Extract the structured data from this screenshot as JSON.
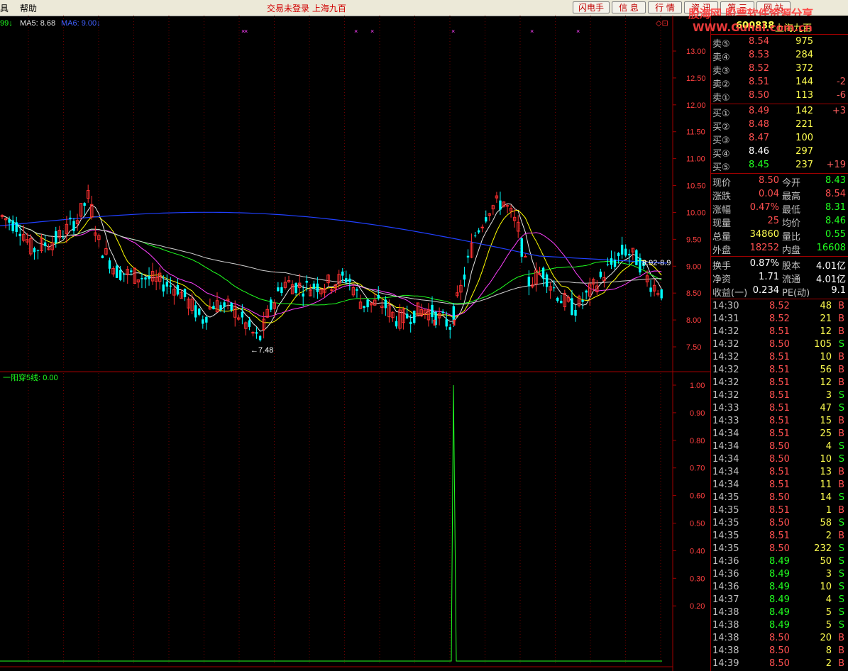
{
  "menubar": {
    "items": [
      "具",
      "帮助"
    ],
    "center_text": "交易未登录  上海九百",
    "buttons": [
      "闪电手",
      "信 息",
      "行 情",
      "资 讯",
      "第 三",
      "网 站"
    ]
  },
  "watermark": {
    "line1": "股海网 股票软件资源分享",
    "line2": "WWW.Guhai.com.cn"
  },
  "stock": {
    "code": "600838",
    "name": "上海九百"
  },
  "ma_legend": {
    "lead": "99↓",
    "ma5": "MA5: 8.68",
    "ma6": "MA6: 9.00↓"
  },
  "price_axis": [
    "13.00",
    "12.50",
    "12.00",
    "11.50",
    "11.00",
    "10.50",
    "10.00",
    "9.50",
    "9.00",
    "8.50",
    "8.00",
    "7.50"
  ],
  "price_annotations": {
    "low": "←7.48",
    "right_label": "8.92-8.9"
  },
  "indicator": {
    "title": "一阳穿5线: 0.00",
    "axis": [
      "1.00",
      "0.90",
      "0.80",
      "0.70",
      "0.60",
      "0.50",
      "0.40",
      "0.30",
      "0.20"
    ]
  },
  "order_book": {
    "sell": [
      {
        "label": "卖⑤",
        "price": "8.54",
        "vol": "975",
        "chg": ""
      },
      {
        "label": "卖④",
        "price": "8.53",
        "vol": "284",
        "chg": ""
      },
      {
        "label": "卖③",
        "price": "8.52",
        "vol": "372",
        "chg": ""
      },
      {
        "label": "卖②",
        "price": "8.51",
        "vol": "144",
        "chg": "-2"
      },
      {
        "label": "卖①",
        "price": "8.50",
        "vol": "113",
        "chg": "-6"
      }
    ],
    "buy": [
      {
        "label": "买①",
        "price": "8.49",
        "vol": "142",
        "chg": "+3"
      },
      {
        "label": "买②",
        "price": "8.48",
        "vol": "221",
        "chg": ""
      },
      {
        "label": "买③",
        "price": "8.47",
        "vol": "100",
        "chg": ""
      },
      {
        "label": "买④",
        "price": "8.46",
        "vol": "297",
        "chg": ""
      },
      {
        "label": "买⑤",
        "price": "8.45",
        "vol": "237",
        "chg": "+19"
      }
    ]
  },
  "quote": {
    "rows": [
      {
        "l1": "现价",
        "v1": "8.50",
        "l2": "今开",
        "v2": "8.43"
      },
      {
        "l1": "涨跌",
        "v1": "0.04",
        "l2": "最高",
        "v2": "8.54"
      },
      {
        "l1": "涨幅",
        "v1": "0.47%",
        "l2": "最低",
        "v2": "8.31"
      },
      {
        "l1": "现量",
        "v1": "25",
        "l2": "均价",
        "v2": "8.46"
      },
      {
        "l1": "总量",
        "v1": "34860",
        "l2": "量比",
        "v2": "0.55"
      },
      {
        "l1": "外盘",
        "v1": "18252",
        "l2": "内盘",
        "v2": "16608"
      }
    ],
    "rows2": [
      {
        "l1": "换手",
        "v1": "0.87%",
        "l2": "股本",
        "v2": "4.01亿"
      },
      {
        "l1": "净资",
        "v1": "1.71",
        "l2": "流通",
        "v2": "4.01亿"
      },
      {
        "l1": "收益(一)",
        "v1": "0.234",
        "l2": "PE(动)",
        "v2": "9.1"
      }
    ]
  },
  "ticks": [
    {
      "t": "14:30",
      "p": "8.52",
      "v": "48",
      "s": "B"
    },
    {
      "t": "14:31",
      "p": "8.52",
      "v": "21",
      "s": "B"
    },
    {
      "t": "14:32",
      "p": "8.51",
      "v": "12",
      "s": "B"
    },
    {
      "t": "14:32",
      "p": "8.50",
      "v": "105",
      "s": "S"
    },
    {
      "t": "14:32",
      "p": "8.51",
      "v": "10",
      "s": "B"
    },
    {
      "t": "14:32",
      "p": "8.51",
      "v": "56",
      "s": "B"
    },
    {
      "t": "14:32",
      "p": "8.51",
      "v": "12",
      "s": "B"
    },
    {
      "t": "14:32",
      "p": "8.51",
      "v": "3",
      "s": "S"
    },
    {
      "t": "14:33",
      "p": "8.51",
      "v": "47",
      "s": "S"
    },
    {
      "t": "14:33",
      "p": "8.51",
      "v": "15",
      "s": "B"
    },
    {
      "t": "14:34",
      "p": "8.51",
      "v": "25",
      "s": "B"
    },
    {
      "t": "14:34",
      "p": "8.50",
      "v": "4",
      "s": "S"
    },
    {
      "t": "14:34",
      "p": "8.50",
      "v": "10",
      "s": "S"
    },
    {
      "t": "14:34",
      "p": "8.51",
      "v": "13",
      "s": "B"
    },
    {
      "t": "14:34",
      "p": "8.51",
      "v": "11",
      "s": "B"
    },
    {
      "t": "14:35",
      "p": "8.50",
      "v": "14",
      "s": "S"
    },
    {
      "t": "14:35",
      "p": "8.51",
      "v": "1",
      "s": "B"
    },
    {
      "t": "14:35",
      "p": "8.50",
      "v": "58",
      "s": "S"
    },
    {
      "t": "14:35",
      "p": "8.51",
      "v": "2",
      "s": "B"
    },
    {
      "t": "14:35",
      "p": "8.50",
      "v": "232",
      "s": "S"
    },
    {
      "t": "14:36",
      "p": "8.49",
      "v": "50",
      "s": "S"
    },
    {
      "t": "14:36",
      "p": "8.49",
      "v": "3",
      "s": "S"
    },
    {
      "t": "14:36",
      "p": "8.49",
      "v": "10",
      "s": "S"
    },
    {
      "t": "14:37",
      "p": "8.49",
      "v": "4",
      "s": "S"
    },
    {
      "t": "14:38",
      "p": "8.49",
      "v": "5",
      "s": "S"
    },
    {
      "t": "14:38",
      "p": "8.49",
      "v": "5",
      "s": "S"
    },
    {
      "t": "14:38",
      "p": "8.50",
      "v": "20",
      "s": "B"
    },
    {
      "t": "14:38",
      "p": "8.50",
      "v": "8",
      "s": "B"
    },
    {
      "t": "14:39",
      "p": "8.50",
      "v": "2",
      "s": "B"
    }
  ],
  "colors": {
    "up": "#ff3030",
    "down": "#00ffff",
    "ma_white": "#e8e8e8",
    "ma_yellow": "#ffff00",
    "ma_magenta": "#ff40ff",
    "ma_green": "#20ff20",
    "ma_blue": "#2040ff",
    "indicator_line": "#20ff20"
  }
}
